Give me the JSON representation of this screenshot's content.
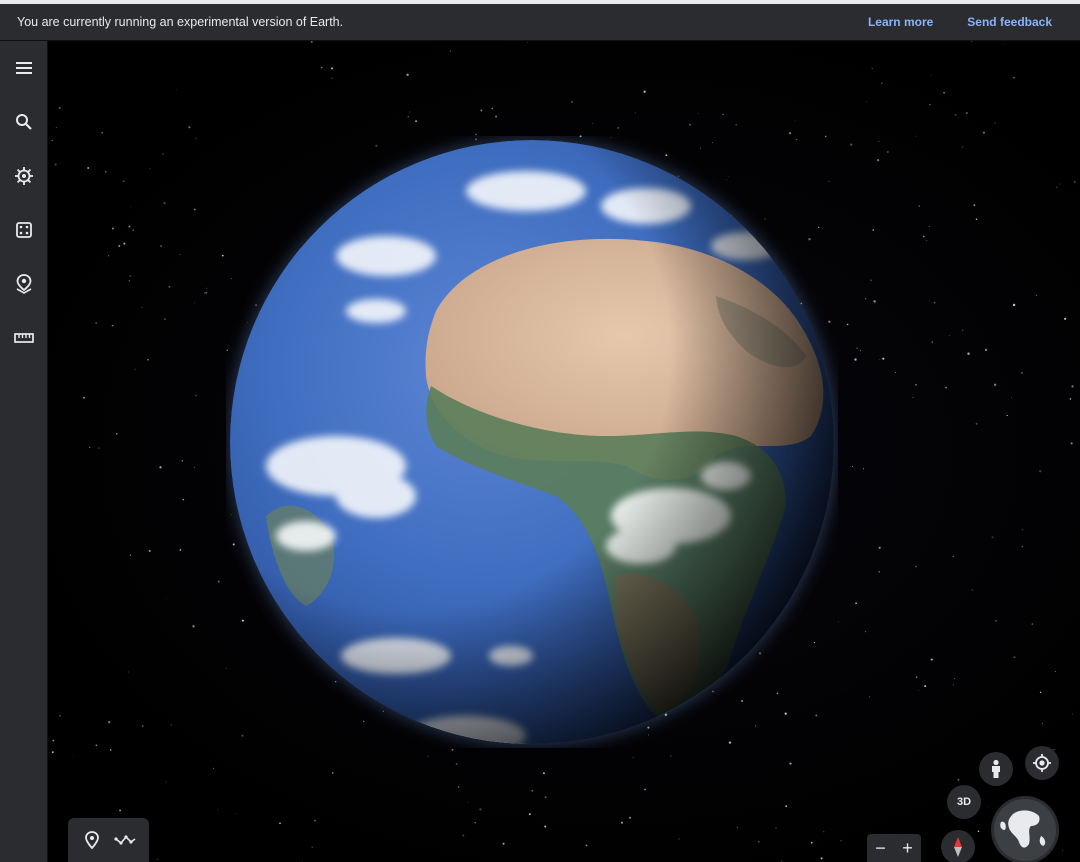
{
  "banner": {
    "message": "You are currently running an experimental version of Earth.",
    "learn_more": "Learn more",
    "send_feedback": "Send feedback"
  },
  "sidebar": {
    "items": [
      {
        "name": "menu-icon"
      },
      {
        "name": "search-icon"
      },
      {
        "name": "voyager-icon"
      },
      {
        "name": "feeling-lucky-icon"
      },
      {
        "name": "projects-icon"
      },
      {
        "name": "measure-icon"
      }
    ]
  },
  "map_controls": {
    "three_d_label": "3D",
    "zoom_out": "−",
    "zoom_in": "+"
  },
  "bottom_tools": [
    {
      "name": "add-placemark-icon"
    },
    {
      "name": "add-path-icon"
    }
  ],
  "colors": {
    "panel": "#2a2c30",
    "link": "#8ab4f8",
    "ocean": "#3f6dbf",
    "land": "#d6b79a",
    "compass_red": "#e53935"
  }
}
